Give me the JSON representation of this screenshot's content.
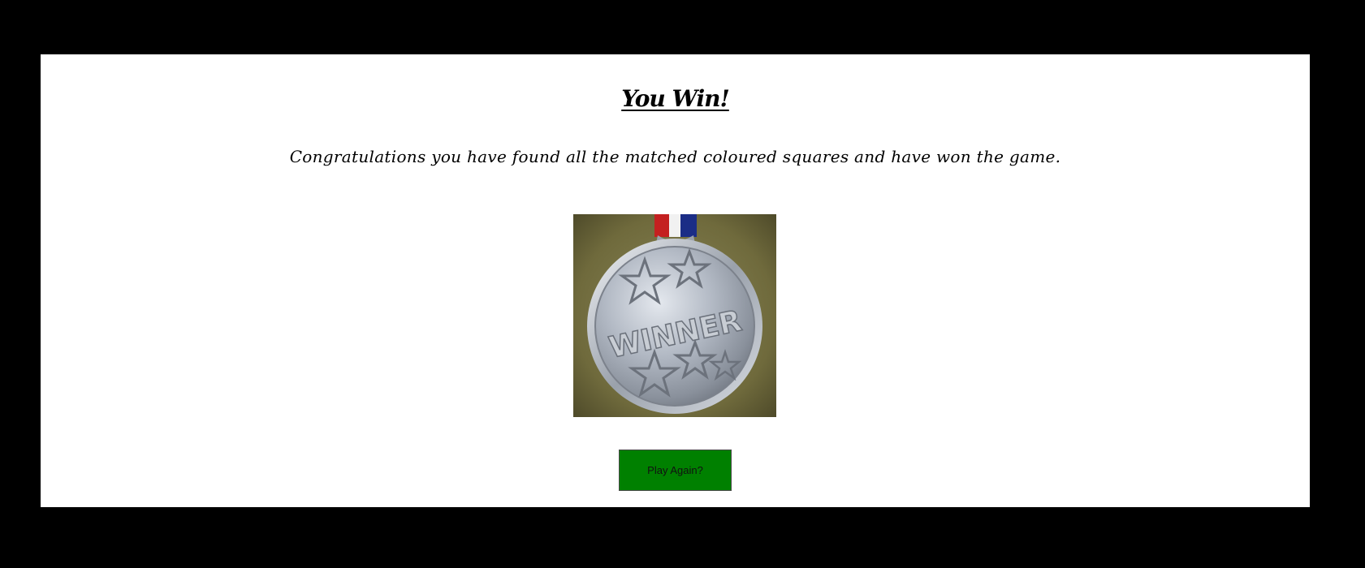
{
  "win_screen": {
    "title": "You Win!",
    "message": "Congratulations you have found all the matched coloured squares and have won the game.",
    "medal_image": {
      "engraved_text": "WINNER",
      "icon": "winner-medal-icon",
      "ribbon_colors": [
        "#cc2222",
        "#ffffff",
        "#1a2f8a"
      ]
    },
    "play_again_label": "Play Again?"
  },
  "colors": {
    "page_background": "#000000",
    "panel_background": "#ffffff",
    "button_background": "#008000"
  }
}
